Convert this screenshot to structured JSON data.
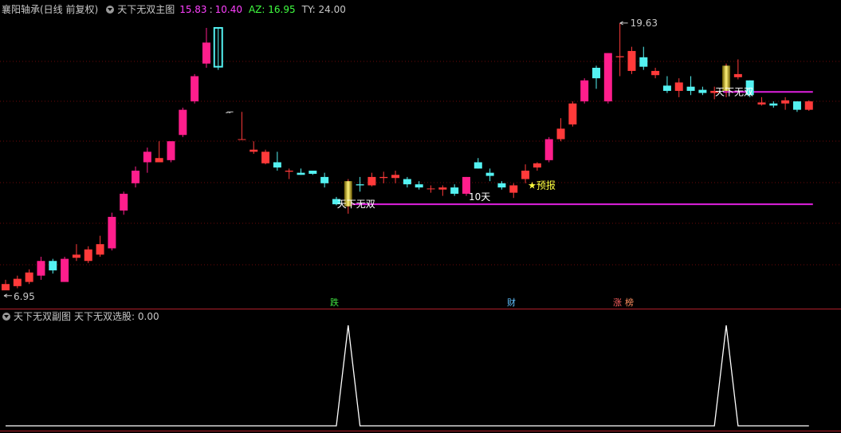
{
  "main_header": {
    "stock": "襄阳轴承(日线 前复权)",
    "indicator": "天下无双主图",
    "val1": "15.83",
    "sep": ":",
    "val2": "10.40",
    "az_label": "AZ: 16.95",
    "ty_label": "TY: 24.00"
  },
  "sub_header": {
    "indicator": "天下无双副图",
    "series_label": "天下无双选股: 0.00"
  },
  "annotations": {
    "low_price": "6.95",
    "high_price": "19.63",
    "signal1": "天下无双",
    "signal2": "天下无双",
    "days": "10天",
    "forecast": "★预报",
    "dash": "--",
    "tag_die": "跌",
    "tag_cai": "财",
    "tag_zhang": "涨",
    "tag_bang": "榜"
  },
  "colors": {
    "up": "#ff3a3a",
    "up_magenta": "#ff1e8c",
    "down": "#54f2f2",
    "signal_line": "#e020e0",
    "gold": "#d4c000",
    "grid": "#6b0a0a",
    "divider": "#b0202a"
  },
  "chart_data": {
    "type": "candlestick",
    "price_range": [
      6.6,
      20.5
    ],
    "candles": [
      {
        "o": 6.9,
        "h": 7.4,
        "l": 6.95,
        "c": 7.2,
        "up": true
      },
      {
        "o": 7.1,
        "h": 7.6,
        "l": 7.0,
        "c": 7.45,
        "up": true
      },
      {
        "o": 7.3,
        "h": 7.9,
        "l": 7.2,
        "c": 7.75,
        "up": true
      },
      {
        "o": 7.6,
        "h": 8.5,
        "l": 7.4,
        "c": 8.3,
        "up": true,
        "mag": true
      },
      {
        "o": 8.3,
        "h": 8.4,
        "l": 7.7,
        "c": 7.85,
        "up": false
      },
      {
        "o": 7.3,
        "h": 8.5,
        "l": 7.3,
        "c": 8.4,
        "up": true,
        "mag": true
      },
      {
        "o": 8.45,
        "h": 9.1,
        "l": 8.3,
        "c": 8.6,
        "up": true
      },
      {
        "o": 8.3,
        "h": 9.0,
        "l": 8.2,
        "c": 8.85,
        "up": true
      },
      {
        "o": 8.6,
        "h": 9.5,
        "l": 8.5,
        "c": 9.1,
        "up": true
      },
      {
        "o": 8.9,
        "h": 10.6,
        "l": 8.8,
        "c": 10.4,
        "up": true,
        "mag": true
      },
      {
        "o": 10.7,
        "h": 11.6,
        "l": 10.5,
        "c": 11.5,
        "up": true,
        "mag": true
      },
      {
        "o": 12.0,
        "h": 12.8,
        "l": 11.8,
        "c": 12.6,
        "up": true,
        "mag": true
      },
      {
        "o": 13.0,
        "h": 13.7,
        "l": 12.5,
        "c": 13.5,
        "up": true,
        "mag": true
      },
      {
        "o": 13.0,
        "h": 14.0,
        "l": 13.0,
        "c": 13.2,
        "up": true
      },
      {
        "o": 13.1,
        "h": 14.0,
        "l": 13.0,
        "c": 14.0,
        "up": true,
        "mag": true
      },
      {
        "o": 14.3,
        "h": 15.6,
        "l": 14.2,
        "c": 15.5,
        "up": true,
        "mag": true
      },
      {
        "o": 15.9,
        "h": 17.2,
        "l": 15.8,
        "c": 17.1,
        "up": true,
        "mag": true
      },
      {
        "o": 18.7,
        "h": 19.4,
        "l": 17.5,
        "c": 17.7,
        "up": true,
        "mag": true
      },
      {
        "o": 19.4,
        "h": 19.4,
        "l": 17.4,
        "c": 17.55,
        "up": false
      },
      {
        "o": 15.4,
        "h": 15.4,
        "l": 15.4,
        "c": 15.4,
        "up": true,
        "dash": true
      },
      {
        "o": 14.1,
        "h": 15.4,
        "l": 14.1,
        "c": 14.1,
        "up": true
      },
      {
        "o": 13.5,
        "h": 14.0,
        "l": 13.4,
        "c": 13.6,
        "up": true
      },
      {
        "o": 13.5,
        "h": 13.6,
        "l": 12.9,
        "c": 12.95,
        "up": true
      },
      {
        "o": 13.0,
        "h": 13.5,
        "l": 12.6,
        "c": 12.75,
        "up": false
      },
      {
        "o": 12.6,
        "h": 12.7,
        "l": 12.2,
        "c": 12.55,
        "up": true
      },
      {
        "o": 12.5,
        "h": 12.7,
        "l": 12.4,
        "c": 12.4,
        "up": false
      },
      {
        "o": 12.6,
        "h": 12.6,
        "l": 12.4,
        "c": 12.45,
        "up": false
      },
      {
        "o": 12.3,
        "h": 12.5,
        "l": 11.8,
        "c": 12.0,
        "up": false
      },
      {
        "o": 11.25,
        "h": 11.35,
        "l": 10.95,
        "c": 11.0,
        "up": false
      },
      {
        "o": 10.9,
        "h": 12.2,
        "l": 10.55,
        "c": 12.1,
        "up": true,
        "gold": true
      },
      {
        "o": 11.9,
        "h": 12.3,
        "l": 11.6,
        "c": 11.95,
        "up": false
      },
      {
        "o": 11.9,
        "h": 12.5,
        "l": 11.85,
        "c": 12.3,
        "up": true
      },
      {
        "o": 12.25,
        "h": 12.55,
        "l": 12.0,
        "c": 12.3,
        "up": true
      },
      {
        "o": 12.25,
        "h": 12.6,
        "l": 12.0,
        "c": 12.4,
        "up": true
      },
      {
        "o": 12.2,
        "h": 12.3,
        "l": 11.8,
        "c": 11.95,
        "up": false
      },
      {
        "o": 11.95,
        "h": 12.1,
        "l": 11.7,
        "c": 11.8,
        "up": false
      },
      {
        "o": 11.75,
        "h": 11.9,
        "l": 11.55,
        "c": 11.75,
        "up": true
      },
      {
        "o": 11.7,
        "h": 11.9,
        "l": 11.4,
        "c": 11.8,
        "up": true
      },
      {
        "o": 11.8,
        "h": 11.95,
        "l": 11.4,
        "c": 11.5,
        "up": false
      },
      {
        "o": 11.5,
        "h": 12.3,
        "l": 11.4,
        "c": 12.3,
        "up": true,
        "mag": true
      },
      {
        "o": 13.0,
        "h": 13.2,
        "l": 12.7,
        "c": 12.7,
        "up": false
      },
      {
        "o": 12.5,
        "h": 12.7,
        "l": 12.1,
        "c": 12.35,
        "up": false
      },
      {
        "o": 12.0,
        "h": 12.1,
        "l": 11.7,
        "c": 11.8,
        "up": false
      },
      {
        "o": 11.55,
        "h": 12.0,
        "l": 11.3,
        "c": 11.9,
        "up": true
      },
      {
        "o": 12.2,
        "h": 12.9,
        "l": 12.0,
        "c": 12.6,
        "up": true
      },
      {
        "o": 12.75,
        "h": 13.0,
        "l": 12.6,
        "c": 12.95,
        "up": true
      },
      {
        "o": 13.1,
        "h": 14.2,
        "l": 13.0,
        "c": 14.1,
        "up": true,
        "mag": true
      },
      {
        "o": 14.1,
        "h": 15.1,
        "l": 14.0,
        "c": 14.6,
        "up": true
      },
      {
        "o": 14.8,
        "h": 15.9,
        "l": 14.7,
        "c": 15.8,
        "up": true
      },
      {
        "o": 15.9,
        "h": 17.0,
        "l": 15.8,
        "c": 16.9,
        "up": true,
        "mag": true
      },
      {
        "o": 17.5,
        "h": 17.6,
        "l": 16.5,
        "c": 17.0,
        "up": false
      },
      {
        "o": 15.9,
        "h": 18.2,
        "l": 15.8,
        "c": 18.2,
        "up": true,
        "mag": true
      },
      {
        "o": 18.0,
        "h": 19.63,
        "l": 17.1,
        "c": 18.05,
        "up": true
      },
      {
        "o": 18.3,
        "h": 18.5,
        "l": 17.2,
        "c": 17.35,
        "up": true
      },
      {
        "o": 18.0,
        "h": 18.5,
        "l": 17.4,
        "c": 17.55,
        "up": false
      },
      {
        "o": 17.35,
        "h": 17.5,
        "l": 17.0,
        "c": 17.15,
        "up": true
      },
      {
        "o": 16.65,
        "h": 17.1,
        "l": 16.3,
        "c": 16.4,
        "up": false
      },
      {
        "o": 16.4,
        "h": 17.0,
        "l": 16.1,
        "c": 16.8,
        "up": true
      },
      {
        "o": 16.6,
        "h": 17.1,
        "l": 16.2,
        "c": 16.4,
        "up": false
      },
      {
        "o": 16.45,
        "h": 16.6,
        "l": 16.2,
        "c": 16.3,
        "up": false
      },
      {
        "o": 16.3,
        "h": 16.6,
        "l": 16.0,
        "c": 16.4,
        "up": true
      },
      {
        "o": 16.4,
        "h": 17.7,
        "l": 16.1,
        "c": 17.6,
        "up": true,
        "gold": true
      },
      {
        "o": 17.05,
        "h": 17.9,
        "l": 16.95,
        "c": 17.2,
        "up": true
      },
      {
        "o": 16.9,
        "h": 16.9,
        "l": 16.1,
        "c": 16.2,
        "up": false
      },
      {
        "o": 15.75,
        "h": 16.1,
        "l": 15.7,
        "c": 15.85,
        "up": true
      },
      {
        "o": 15.8,
        "h": 15.9,
        "l": 15.6,
        "c": 15.7,
        "up": false
      },
      {
        "o": 15.8,
        "h": 16.1,
        "l": 15.5,
        "c": 15.95,
        "up": true
      },
      {
        "o": 15.5,
        "h": 15.9,
        "l": 15.4,
        "c": 15.9,
        "up": false
      },
      {
        "o": 15.5,
        "h": 15.95,
        "l": 15.45,
        "c": 15.9,
        "up": true
      }
    ],
    "signal_lines": [
      {
        "from_index": 29,
        "to_index": 68,
        "price": 11.0
      },
      {
        "from_index": 61,
        "to_index": 68,
        "price": 16.35
      }
    ],
    "sub_series": {
      "name": "天下无双选股",
      "value": 0.0,
      "spikes_at_index": [
        29,
        61
      ],
      "spike_value": 1.0
    }
  }
}
